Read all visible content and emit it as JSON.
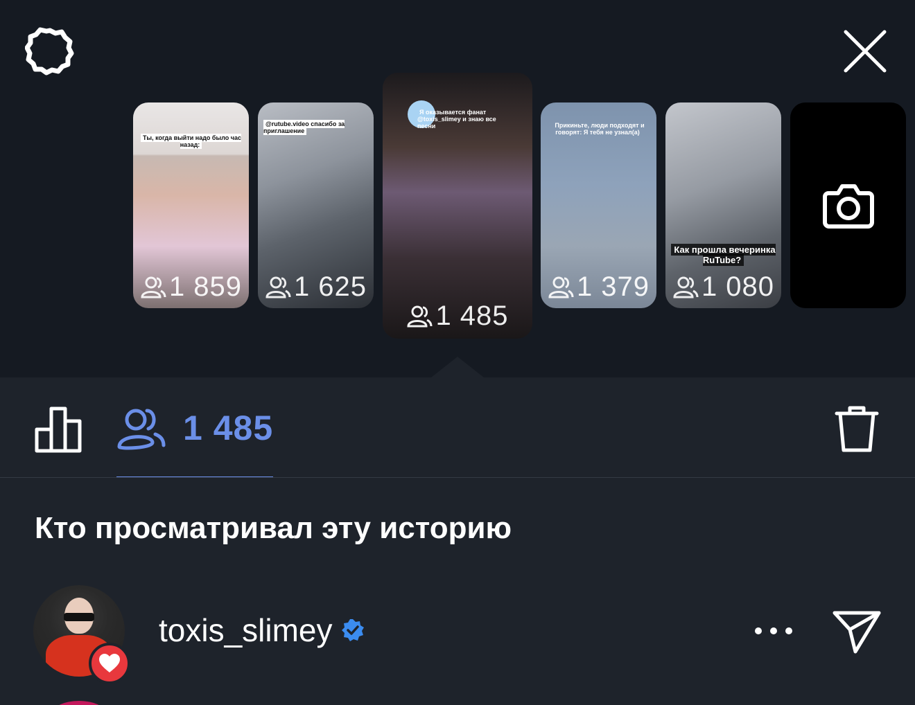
{
  "header": {
    "settings_icon": "gear-icon",
    "close_icon": "close-icon"
  },
  "stories": [
    {
      "caption": "Ты, когда выйти надо было час назад:",
      "viewers": "1 859"
    },
    {
      "caption": "@rutube.video спасибо за приглашение",
      "viewers": "1 625"
    },
    {
      "caption": "Я оказывается фанат @toxis_slimey и знаю все песни",
      "viewers": "1 485"
    },
    {
      "caption": "Прикиньте, люди подходят и говорят: Я тебя не узнал(а)",
      "viewers": "1 379"
    },
    {
      "caption": "Как прошла вечеринка RuTube?",
      "viewers": "1 080"
    }
  ],
  "add_story_icon": "camera-icon",
  "toolbar": {
    "stats_icon": "bar-chart-icon",
    "viewers_icon": "people-icon",
    "viewers_count": "1 485",
    "delete_icon": "trash-icon"
  },
  "section_title": "Кто просматривал эту историю",
  "viewers_list": [
    {
      "username": "toxis_slimey",
      "verified": true,
      "reaction": "heart-icon"
    }
  ],
  "colors": {
    "background": "#151a22",
    "panel": "#1e232b",
    "accent": "#6b8fe8",
    "verified": "#3b8cf0",
    "like": "#e8383d"
  }
}
